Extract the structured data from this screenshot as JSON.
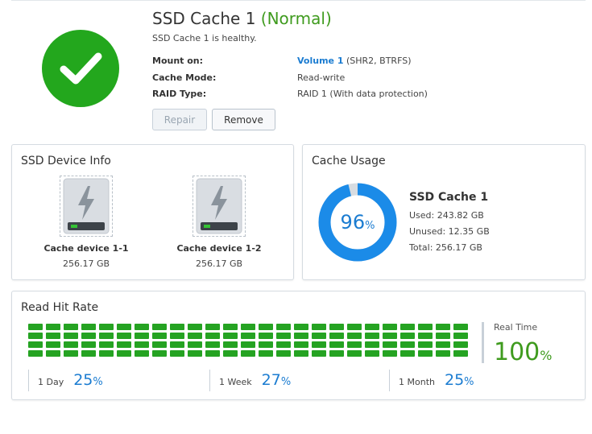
{
  "header": {
    "title": "SSD Cache 1",
    "status": "(Normal)",
    "subtitle": "SSD Cache 1 is healthy.",
    "status_color": "#23a71d",
    "icon": "check-icon"
  },
  "info": {
    "mount_label": "Mount on:",
    "mount_volume": "Volume 1",
    "mount_detail": "(SHR2, BTRFS)",
    "mode_label": "Cache Mode:",
    "mode_value": "Read-write",
    "raid_label": "RAID Type:",
    "raid_value": "RAID 1 (With data protection)"
  },
  "buttons": {
    "repair": "Repair",
    "remove": "Remove"
  },
  "ssd_device_info": {
    "title": "SSD Device Info",
    "devices": [
      {
        "name": "Cache device 1-1",
        "size": "256.17 GB",
        "icon": "ssd-drive-icon"
      },
      {
        "name": "Cache device 1-2",
        "size": "256.17 GB",
        "icon": "ssd-drive-icon"
      }
    ]
  },
  "cache_usage": {
    "title": "Cache Usage",
    "percent": 96,
    "percent_text": "96",
    "percent_sign": "%",
    "name": "SSD Cache 1",
    "used": "Used: 243.82 GB",
    "unused": "Unused: 12.35 GB",
    "total": "Total: 256.17 GB",
    "used_color": "#1b8be8",
    "unused_color": "#d7dce1"
  },
  "read_hit_rate": {
    "title": "Read Hit Rate",
    "bar_color": "#25a322",
    "bar_rows": 4,
    "bar_cols": 25,
    "real_time_label": "Real Time",
    "real_time_value": "100",
    "real_time_sign": "%",
    "periods": [
      {
        "label": "1 Day",
        "value": "25",
        "sign": "%"
      },
      {
        "label": "1 Week",
        "value": "27",
        "sign": "%"
      },
      {
        "label": "1 Month",
        "value": "25",
        "sign": "%"
      }
    ]
  }
}
